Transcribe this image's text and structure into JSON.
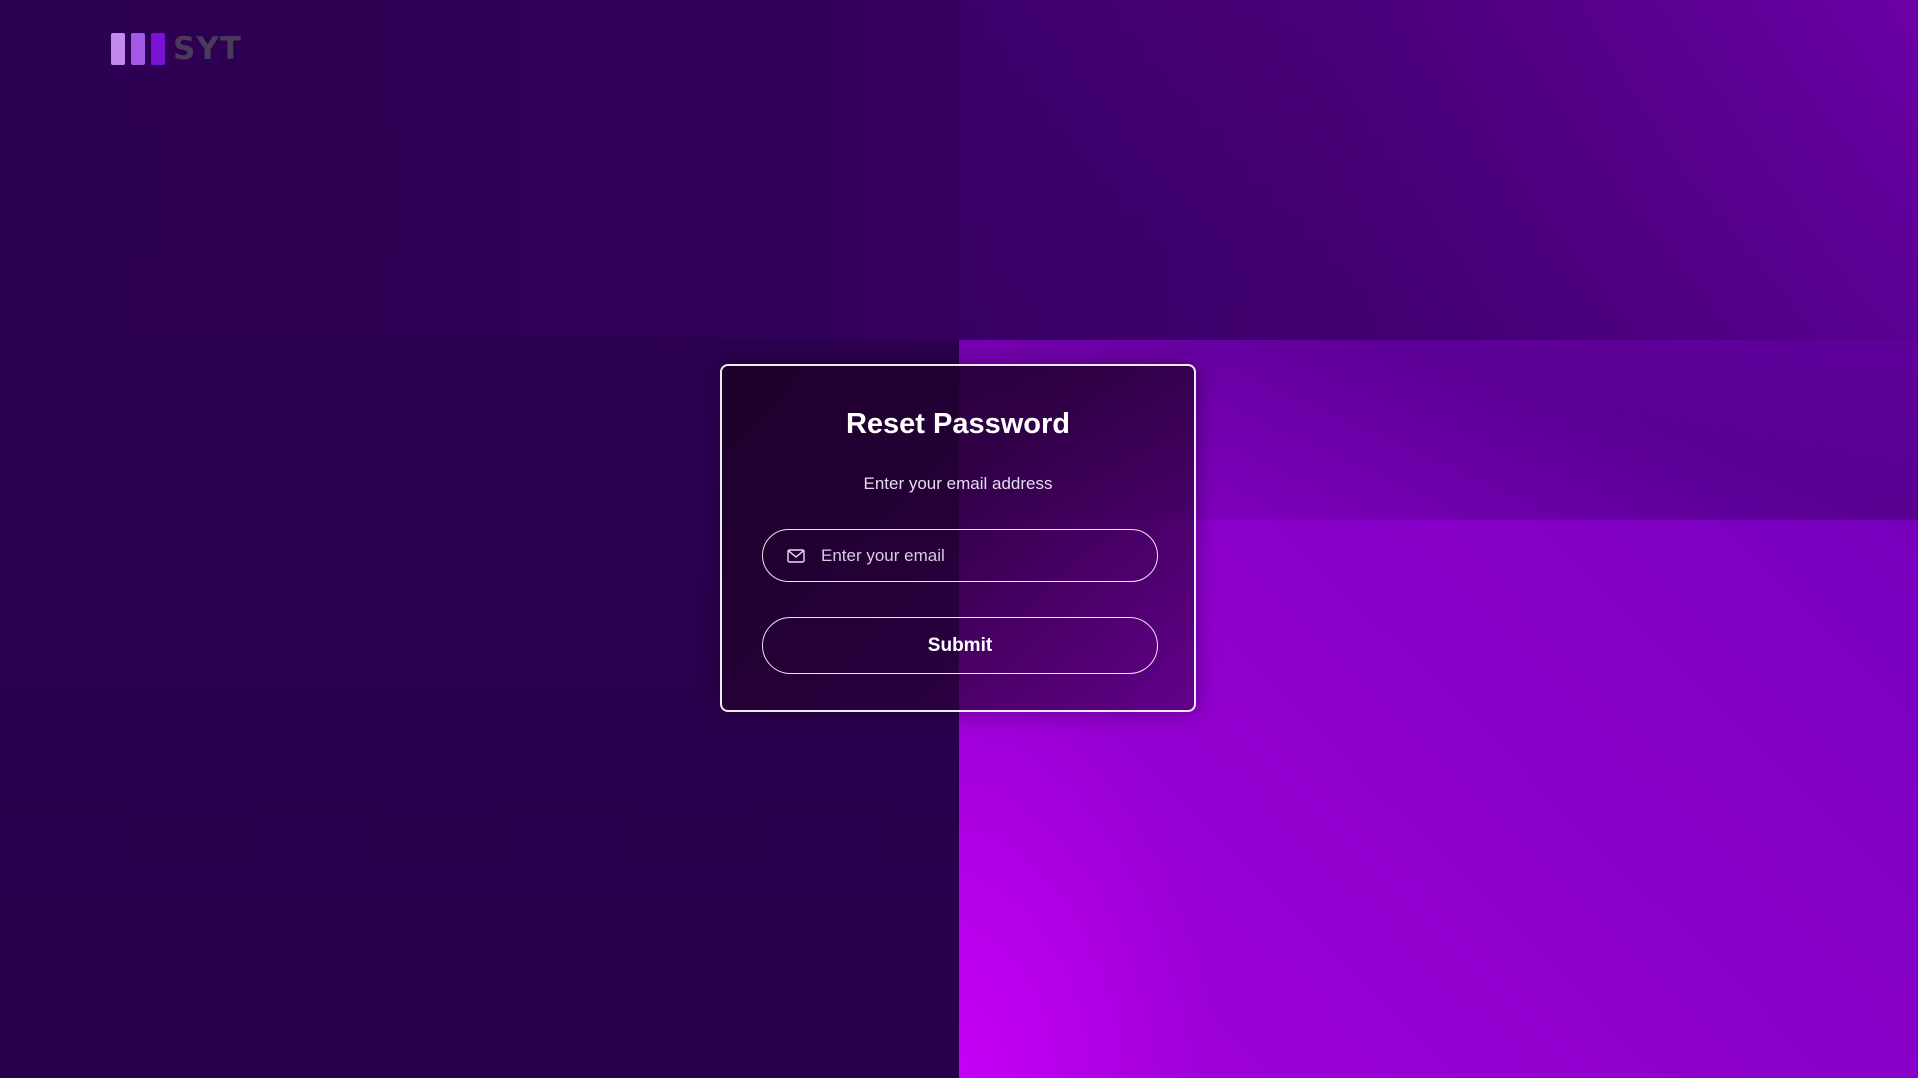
{
  "brand": {
    "name": "SYT",
    "bar_colors": [
      "#c48af0",
      "#a45ae6",
      "#7a12d4"
    ]
  },
  "reset_form": {
    "title": "Reset Password",
    "subtitle": "Enter your email address",
    "email_placeholder": "Enter your email",
    "email_icon": "mail-icon",
    "submit_label": "Submit"
  },
  "colors": {
    "background_dark": "#2b0050",
    "background_accent": "#a400dc",
    "card_border": "#ffffff"
  }
}
